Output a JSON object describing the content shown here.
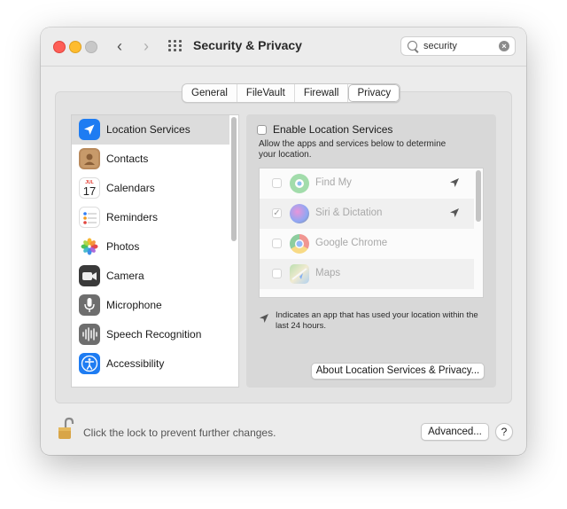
{
  "window": {
    "title": "Security & Privacy"
  },
  "toolbar": {
    "back_icon": "chevron-left-icon",
    "forward_icon": "chevron-right-icon",
    "show_all_icon": "grid-icon"
  },
  "search": {
    "value": "security",
    "clear_icon": "clear-icon"
  },
  "tabs": [
    {
      "label": "General",
      "active": false
    },
    {
      "label": "FileVault",
      "active": false
    },
    {
      "label": "Firewall",
      "active": false
    },
    {
      "label": "Privacy",
      "active": true
    }
  ],
  "sidebar": {
    "items": [
      {
        "label": "Location Services",
        "icon": "location-arrow-icon",
        "selected": true
      },
      {
        "label": "Contacts",
        "icon": "contacts-icon",
        "selected": false
      },
      {
        "label": "Calendars",
        "icon": "calendar-icon",
        "selected": false
      },
      {
        "label": "Reminders",
        "icon": "reminders-icon",
        "selected": false
      },
      {
        "label": "Photos",
        "icon": "photos-icon",
        "selected": false
      },
      {
        "label": "Camera",
        "icon": "camera-icon",
        "selected": false
      },
      {
        "label": "Microphone",
        "icon": "microphone-icon",
        "selected": false
      },
      {
        "label": "Speech Recognition",
        "icon": "speech-waveform-icon",
        "selected": false
      },
      {
        "label": "Accessibility",
        "icon": "accessibility-icon",
        "selected": false
      }
    ],
    "calendar_month": "JUL",
    "calendar_day": "17"
  },
  "location": {
    "enable_label": "Enable Location Services",
    "enabled": false,
    "description": "Allow the apps and services below to determine your location.",
    "apps": [
      {
        "name": "Find My",
        "checked": false,
        "icon": "find-my-icon",
        "recent_use": true
      },
      {
        "name": "Siri & Dictation",
        "checked": true,
        "icon": "siri-icon",
        "recent_use": true
      },
      {
        "name": "Google Chrome",
        "checked": false,
        "icon": "chrome-icon",
        "recent_use": false
      },
      {
        "name": "Maps",
        "checked": false,
        "icon": "maps-icon",
        "recent_use": false
      }
    ],
    "legend": "Indicates an app that has used your location within the last 24 hours.",
    "about_button": "About Location Services & Privacy..."
  },
  "footer": {
    "lock_text": "Click the lock to prevent further changes.",
    "advanced_button": "Advanced...",
    "help_button": "?"
  },
  "colors": {
    "accent": "#1e7cf2",
    "close": "#fe5f57",
    "minimize": "#febc2e"
  }
}
